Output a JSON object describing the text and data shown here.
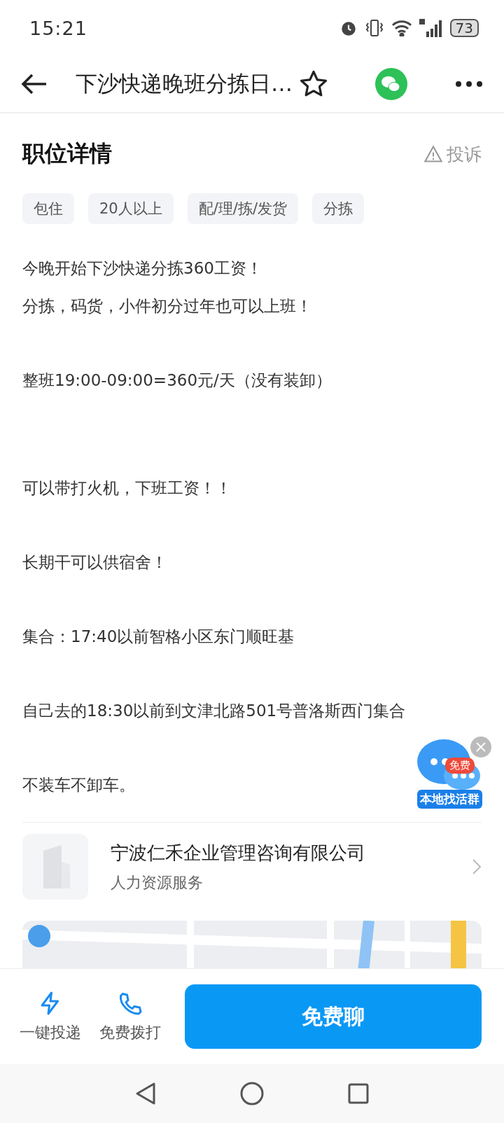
{
  "status_bar": {
    "time": "15:21",
    "battery": "73"
  },
  "header": {
    "title": "下沙快递晚班分拣日…"
  },
  "section": {
    "title": "职位详情",
    "report": "投诉"
  },
  "tags": [
    "包住",
    "20人以上",
    "配/理/拣/发货",
    "分拣"
  ],
  "paragraphs": [
    [
      "今晚开始下沙快递分拣360工资！",
      "分拣，码货，小件初分过年也可以上班！"
    ],
    [
      "整班19:00-09:00=360元/天（没有装卸）"
    ],
    [
      "可以带打火机，下班工资！！"
    ],
    [
      "长期干可以供宿舍！"
    ],
    [
      "集合：17:40以前智格小区东门顺旺基"
    ],
    [
      "自己去的18:30以前到文津北路501号普洛斯西门集合"
    ],
    [
      "不装车不卸车。"
    ]
  ],
  "floating_widget": {
    "badge": "免费",
    "label": "本地找活群"
  },
  "company": {
    "name": "宁波仁禾企业管理咨询有限公司",
    "industry": "人力资源服务"
  },
  "map": {
    "kind": "picture"
  },
  "bottom_bar": {
    "actions": [
      {
        "kind": "bolt",
        "label": "一键投递"
      },
      {
        "kind": "phone",
        "label": "免费拨打"
      }
    ],
    "primary": "免费聊"
  }
}
